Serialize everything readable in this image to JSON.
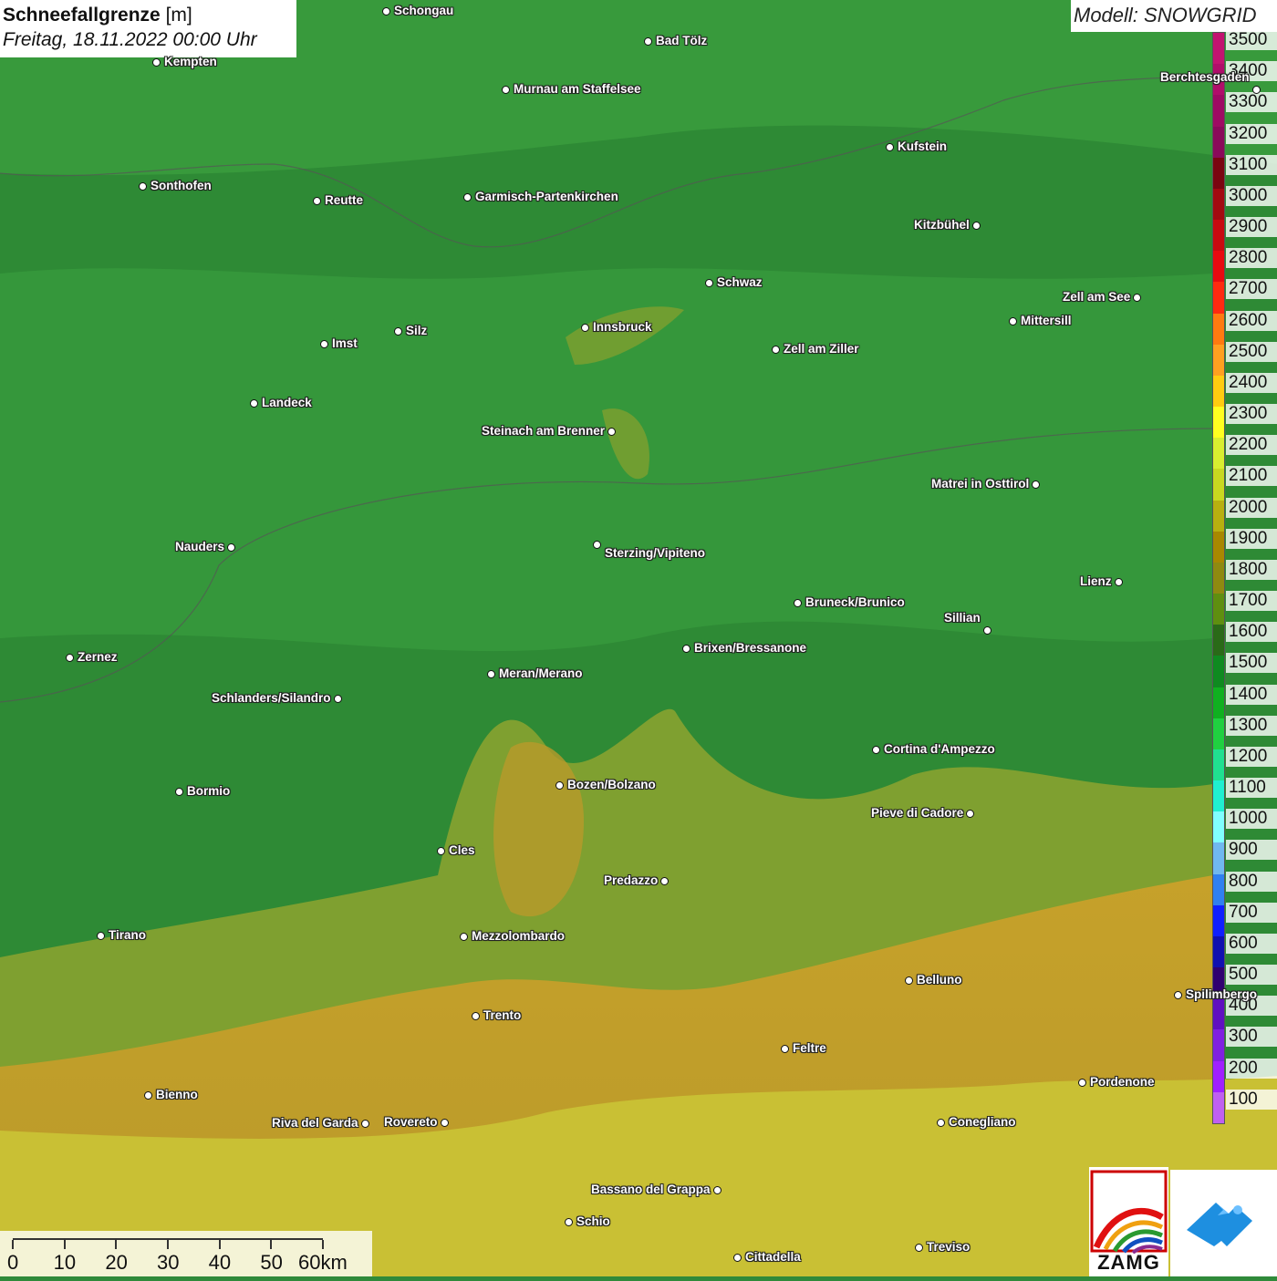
{
  "header": {
    "title_bold": "Schneefallgrenze",
    "title_unit": "[m]",
    "date": "Freitag, 18.11.2022 00:00 Uhr"
  },
  "model": {
    "label": "Modell: SNOWGRID"
  },
  "legend": {
    "entries": [
      {
        "label": "3500",
        "color": "#c21470"
      },
      {
        "label": "3400",
        "color": "#b00e6a"
      },
      {
        "label": "3300",
        "color": "#9e0b63"
      },
      {
        "label": "3200",
        "color": "#8a0a5a"
      },
      {
        "label": "3100",
        "color": "#7a0510"
      },
      {
        "label": "3000",
        "color": "#a20a10"
      },
      {
        "label": "2900",
        "color": "#c80a10"
      },
      {
        "label": "2800",
        "color": "#e80a10"
      },
      {
        "label": "2700",
        "color": "#ff2a10"
      },
      {
        "label": "2600",
        "color": "#ff7a10"
      },
      {
        "label": "2500",
        "color": "#ffa020"
      },
      {
        "label": "2400",
        "color": "#ffcc10"
      },
      {
        "label": "2300",
        "color": "#ffff20"
      },
      {
        "label": "2200",
        "color": "#d8ee30"
      },
      {
        "label": "2100",
        "color": "#c8d820"
      },
      {
        "label": "2000",
        "color": "#b8b010"
      },
      {
        "label": "1900",
        "color": "#a88800"
      },
      {
        "label": "1800",
        "color": "#8f8a10"
      },
      {
        "label": "1700",
        "color": "#5f8f10"
      },
      {
        "label": "1600",
        "color": "#2a6a18"
      },
      {
        "label": "1500",
        "color": "#0f8a20"
      },
      {
        "label": "1400",
        "color": "#10b020"
      },
      {
        "label": "1300",
        "color": "#20d040"
      },
      {
        "label": "1200",
        "color": "#20e090"
      },
      {
        "label": "1100",
        "color": "#20f0d0"
      },
      {
        "label": "1000",
        "color": "#80ffff"
      },
      {
        "label": "900",
        "color": "#70b8f0"
      },
      {
        "label": "800",
        "color": "#3080f0"
      },
      {
        "label": "700",
        "color": "#1020ff"
      },
      {
        "label": "600",
        "color": "#1010b0"
      },
      {
        "label": "500",
        "color": "#300070"
      },
      {
        "label": "400",
        "color": "#6010c0"
      },
      {
        "label": "300",
        "color": "#8020e0"
      },
      {
        "label": "200",
        "color": "#a020ff"
      },
      {
        "label": "100",
        "color": "#c060f0"
      }
    ]
  },
  "cities": [
    {
      "name": "Schongau"
    },
    {
      "name": "Bad Tölz"
    },
    {
      "name": "Kempten"
    },
    {
      "name": "Murnau am Staffelsee"
    },
    {
      "name": "Berchtesgaden"
    },
    {
      "name": "Kufstein"
    },
    {
      "name": "Sonthofen"
    },
    {
      "name": "Reutte"
    },
    {
      "name": "Garmisch-Partenkirchen"
    },
    {
      "name": "Kitzbühel"
    },
    {
      "name": "Schwaz"
    },
    {
      "name": "Zell am See"
    },
    {
      "name": "Innsbruck"
    },
    {
      "name": "Mittersill"
    },
    {
      "name": "Imst"
    },
    {
      "name": "Silz"
    },
    {
      "name": "Zell am Ziller"
    },
    {
      "name": "Landeck"
    },
    {
      "name": "Steinach am Brenner"
    },
    {
      "name": "Matrei in Osttirol"
    },
    {
      "name": "Nauders"
    },
    {
      "name": "Sterzing/Vipiteno"
    },
    {
      "name": "Lienz"
    },
    {
      "name": "Bruneck/Brunico"
    },
    {
      "name": "Sillian"
    },
    {
      "name": "Zernez"
    },
    {
      "name": "Brixen/Bressanone"
    },
    {
      "name": "Meran/Merano"
    },
    {
      "name": "Schlanders/Silandro"
    },
    {
      "name": "Cortina d'Ampezzo"
    },
    {
      "name": "Bozen/Bolzano"
    },
    {
      "name": "Bormio"
    },
    {
      "name": "Pieve di Cadore"
    },
    {
      "name": "Cles"
    },
    {
      "name": "Predazzo"
    },
    {
      "name": "Tirano"
    },
    {
      "name": "Mezzolombardo"
    },
    {
      "name": "Belluno"
    },
    {
      "name": "Spilimbergo"
    },
    {
      "name": "Trento"
    },
    {
      "name": "Feltre"
    },
    {
      "name": "Pordenone"
    },
    {
      "name": "Bienno"
    },
    {
      "name": "Riva del Garda"
    },
    {
      "name": "Rovereto"
    },
    {
      "name": "Conegliano"
    },
    {
      "name": "Bassano del Grappa"
    },
    {
      "name": "Schio"
    },
    {
      "name": "Treviso"
    },
    {
      "name": "Cittadella"
    }
  ],
  "scale": {
    "labels": [
      "0",
      "10",
      "20",
      "30",
      "40",
      "50",
      "60km"
    ]
  },
  "logos": {
    "zamg_text": "ZAMG"
  }
}
